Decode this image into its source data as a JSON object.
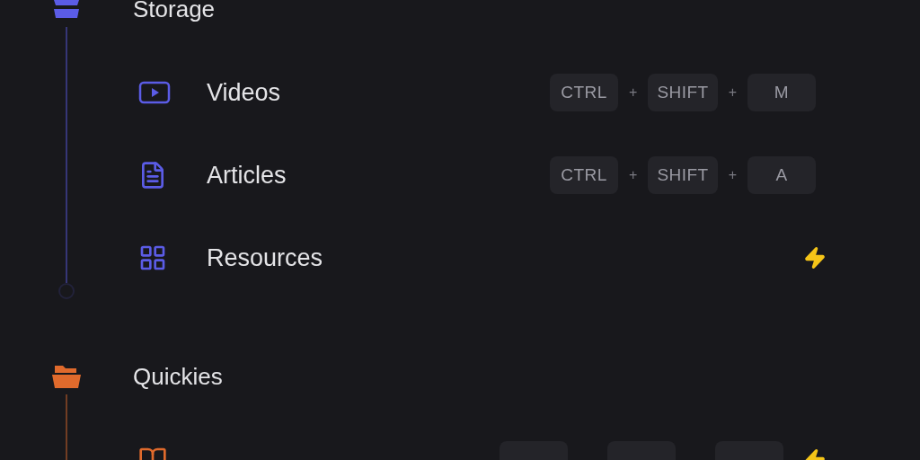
{
  "groups": [
    {
      "title": "Storage",
      "color": "#5b5ce6",
      "items": [
        {
          "label": "Videos",
          "separator": "+",
          "shortcut": [
            "CTRL",
            "SHIFT",
            "M"
          ],
          "flash": false
        },
        {
          "label": "Articles",
          "separator": "+",
          "shortcut": [
            "CTRL",
            "SHIFT",
            "A"
          ],
          "flash": false
        },
        {
          "label": "Resources",
          "flash": true
        }
      ]
    },
    {
      "title": "Quickies",
      "color": "#e06a2c",
      "items": [
        {
          "blank_keys": [
            {
              "kind": "key"
            },
            {
              "kind": "key"
            },
            {
              "kind": "key"
            }
          ],
          "flash": true
        }
      ]
    }
  ]
}
